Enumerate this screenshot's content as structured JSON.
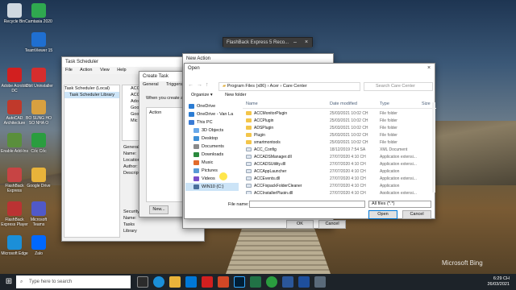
{
  "desktop": {
    "icons": [
      {
        "label": "Recycle Bin",
        "color": "#cfd8e0"
      },
      {
        "label": "TeamViewer 15",
        "color": "#1f6fd1"
      },
      {
        "label": "Camtasia 2020",
        "color": "#2fa84f"
      },
      {
        "label": "Adobe Acrobat DC",
        "color": "#d21f1f"
      },
      {
        "label": "IObit Uninstaller",
        "color": "#d62d2d"
      },
      {
        "label": "AutoCAD Architecture",
        "color": "#c0392b"
      },
      {
        "label": "BO SUNG HO SO NHA O",
        "color": "#d8a040"
      },
      {
        "label": "Enable Add-Ins",
        "color": "#5a8f3c"
      },
      {
        "label": "Cốc Cốc",
        "color": "#2a9d3f"
      },
      {
        "label": "FlashBack Express",
        "color": "#c74444"
      },
      {
        "label": "Google Drive",
        "color": "#e8b33a"
      },
      {
        "label": "FlashBack Express Player",
        "color": "#b33"
      },
      {
        "label": "Microsoft Teams",
        "color": "#5059c9"
      },
      {
        "label": "Microsoft Edge",
        "color": "#1b8fd8"
      },
      {
        "label": "Zalo",
        "color": "#0068ff"
      }
    ]
  },
  "flashback": {
    "title": "FlashBack Express 5 Reco..."
  },
  "task_scheduler": {
    "title": "Task Scheduler",
    "menu": [
      "File",
      "Action",
      "View",
      "Help"
    ],
    "tree": [
      "Task Scheduler (Local)",
      "Task Scheduler Library"
    ],
    "center_rows": [
      "ACC",
      "ACC",
      "Ado",
      "Goo",
      "Goo",
      "Mic"
    ],
    "general_label": "General",
    "right_label": "Name:",
    "side_texts": [
      "Location:",
      "Author:",
      "Description:"
    ],
    "bottom_texts": [
      "Security",
      "Name:",
      "Tasks",
      "Library"
    ]
  },
  "create_task": {
    "title": "Create Task",
    "tabs": [
      "General",
      "Triggers"
    ],
    "prompt": "When you create a",
    "action_col": "Action",
    "new_btn": "New..."
  },
  "new_action": {
    "title": "New Action"
  },
  "open_dialog": {
    "title": "Open",
    "address": [
      "Program Files (x86)",
      "Acer",
      "Care Center"
    ],
    "search_placeholder": "Search Care Center",
    "organize": "Organize",
    "new_folder": "New folder",
    "columns": {
      "name": "Name",
      "date": "Date modified",
      "type": "Type",
      "size": "Size"
    },
    "nav": [
      {
        "label": "OneDrive",
        "color": "#2b7cd3"
      },
      {
        "label": "OneDrive - Van La",
        "color": "#2b7cd3"
      },
      {
        "label": "This PC",
        "color": "#3a7bd5"
      },
      {
        "label": "3D Objects",
        "color": "#6aa9e9"
      },
      {
        "label": "Desktop",
        "color": "#3d8fd6"
      },
      {
        "label": "Documents",
        "color": "#8a8a8a"
      },
      {
        "label": "Downloads",
        "color": "#2b8a3e"
      },
      {
        "label": "Music",
        "color": "#e26b2b"
      },
      {
        "label": "Pictures",
        "color": "#5a9bd5"
      },
      {
        "label": "Videos",
        "color": "#7a4fc9"
      },
      {
        "label": "WIN10 (C:)",
        "color": "#4a6f9a"
      }
    ],
    "files": [
      {
        "name": "ACCMonitorPlugin",
        "date": "25/03/2021 10:02 CH",
        "type": "File folder",
        "folder": true
      },
      {
        "name": "ACCPlugin",
        "date": "25/03/2021 10:02 CH",
        "type": "File folder",
        "folder": true
      },
      {
        "name": "ADSPlugin",
        "date": "25/03/2021 10:02 CH",
        "type": "File folder",
        "folder": true
      },
      {
        "name": "Plugin",
        "date": "25/03/2021 10:02 CH",
        "type": "File folder",
        "folder": true
      },
      {
        "name": "smartmontools",
        "date": "25/03/2021 10:02 CH",
        "type": "File folder",
        "folder": true
      },
      {
        "name": "ACC_Config",
        "date": "18/12/2019 7:54 SA",
        "type": "XML Document",
        "folder": false
      },
      {
        "name": "ACCADSManager.dll",
        "date": "27/07/2020 4:10 CH",
        "type": "Application extensi...",
        "folder": false
      },
      {
        "name": "ACCADSUtility.dll",
        "date": "27/07/2020 4:10 CH",
        "type": "Application extensi...",
        "folder": false
      },
      {
        "name": "ACCAppLauncher",
        "date": "27/07/2020 4:10 CH",
        "type": "Application",
        "folder": false
      },
      {
        "name": "ACCEvents.dll",
        "date": "27/07/2020 4:10 CH",
        "type": "Application extensi...",
        "folder": false
      },
      {
        "name": "ACCFixpackFolderCleaner",
        "date": "27/07/2020 4:10 CH",
        "type": "Application",
        "folder": false
      },
      {
        "name": "ACCInstallerPlugin.dll",
        "date": "27/07/2020 4:10 CH",
        "type": "Application extensi...",
        "folder": false
      }
    ],
    "filename_label": "File name:",
    "filetype": "All files (*.*)",
    "open_btn": "Open",
    "cancel_btn": "Cancel"
  },
  "new_action_buttons": {
    "ok": "OK",
    "cancel": "Cancel"
  },
  "taskbar": {
    "search_placeholder": "Type here to search",
    "time": "6:29 CH",
    "date": "26/03/2021"
  },
  "watermark": "Microsoft Bing"
}
